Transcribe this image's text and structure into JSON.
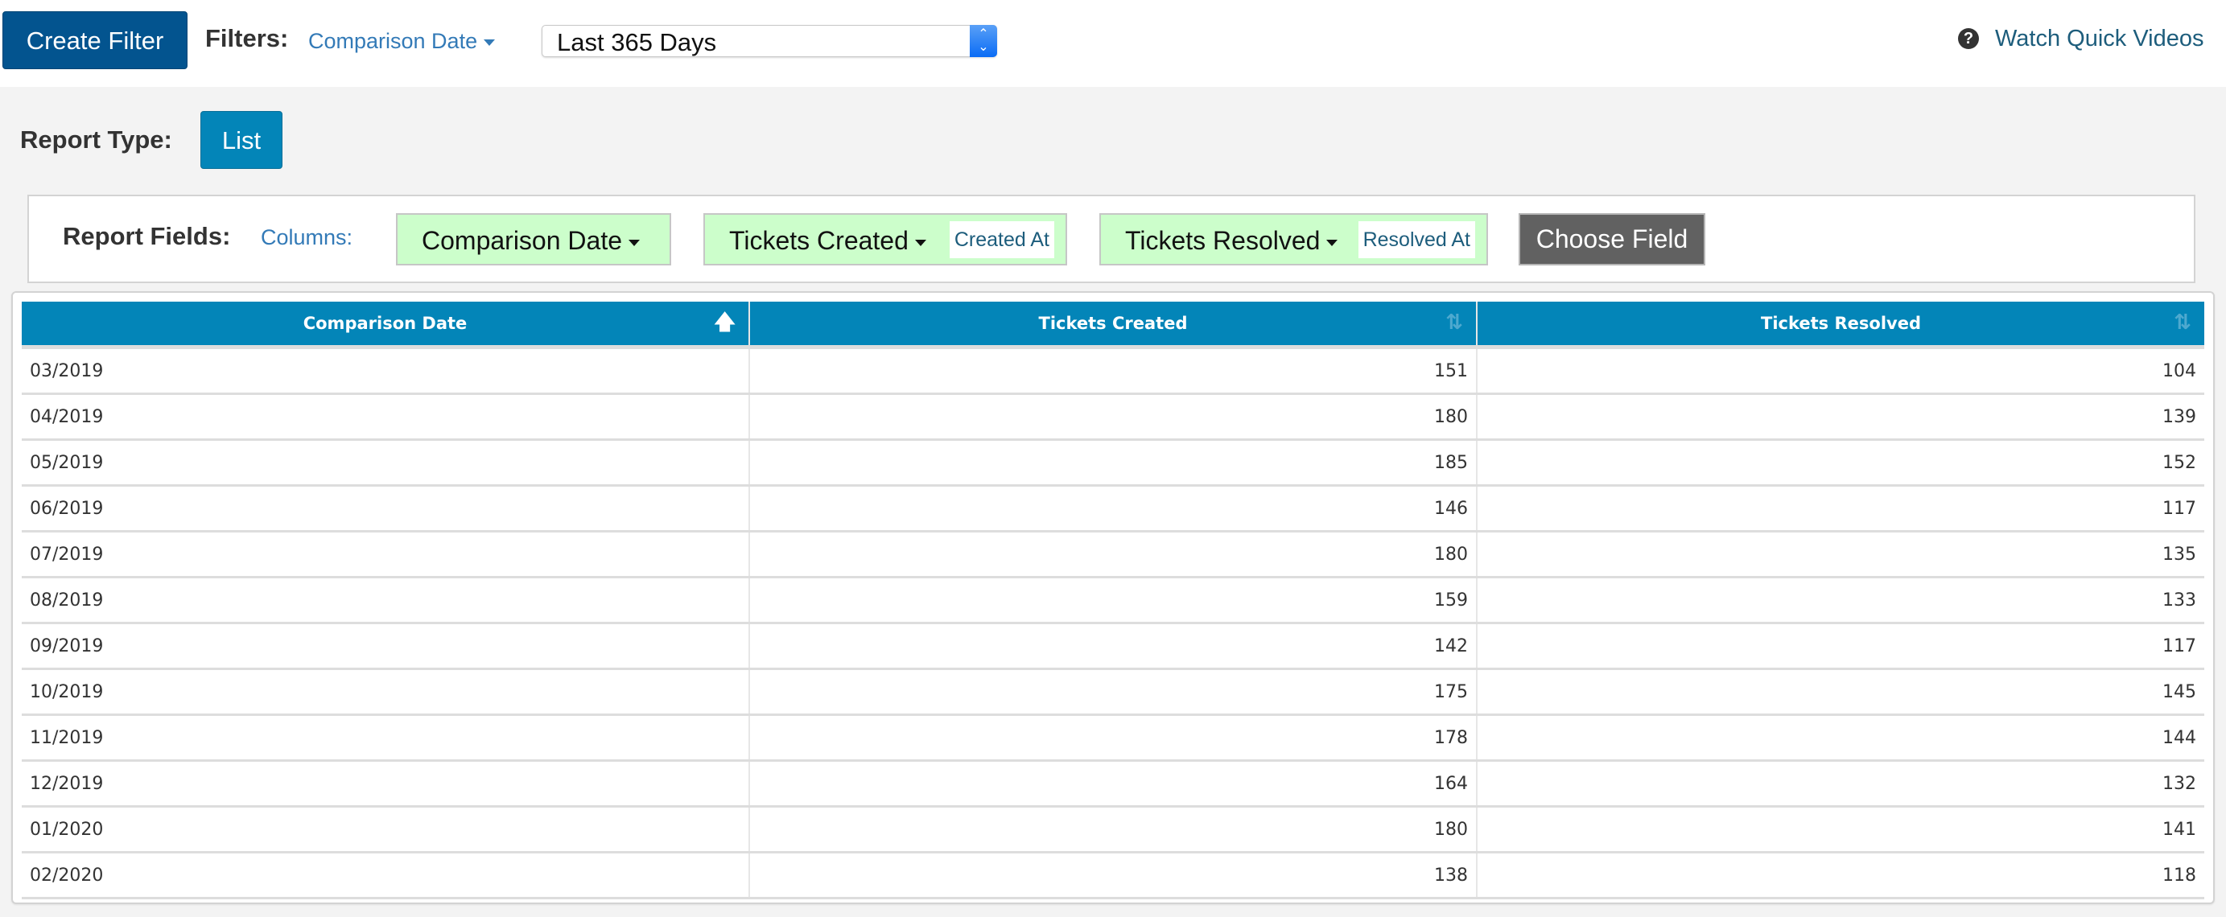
{
  "topbar": {
    "create_filter_label": "Create Filter",
    "filters_label": "Filters:",
    "filter_field": "Comparison Date",
    "date_range_value": "Last 365 Days",
    "help_icon": "question-circle-icon",
    "watch_videos_label": "Watch Quick Videos"
  },
  "report_type": {
    "label": "Report Type:",
    "value": "List"
  },
  "report_fields": {
    "label": "Report Fields:",
    "columns_label": "Columns:",
    "fields": [
      {
        "name": "Comparison Date",
        "sub": null
      },
      {
        "name": "Tickets Created",
        "sub": "Created At"
      },
      {
        "name": "Tickets Resolved",
        "sub": "Resolved At"
      }
    ],
    "choose_field_label": "Choose Field",
    "chip_color": "#ccfecb"
  },
  "table": {
    "header_color": "#0385b8",
    "columns": [
      {
        "label": "Comparison Date",
        "sort": "asc",
        "sort_icon": "sort-up-arrow-icon"
      },
      {
        "label": "Tickets Created",
        "sort": "none",
        "sort_icon": "sort-both-icon"
      },
      {
        "label": "Tickets Resolved",
        "sort": "none",
        "sort_icon": "sort-both-icon"
      }
    ],
    "rows": [
      [
        "03/2019",
        "151",
        "104"
      ],
      [
        "04/2019",
        "180",
        "139"
      ],
      [
        "05/2019",
        "185",
        "152"
      ],
      [
        "06/2019",
        "146",
        "117"
      ],
      [
        "07/2019",
        "180",
        "135"
      ],
      [
        "08/2019",
        "159",
        "133"
      ],
      [
        "09/2019",
        "142",
        "117"
      ],
      [
        "10/2019",
        "175",
        "145"
      ],
      [
        "11/2019",
        "178",
        "144"
      ],
      [
        "12/2019",
        "164",
        "132"
      ],
      [
        "01/2020",
        "180",
        "141"
      ],
      [
        "02/2020",
        "138",
        "118"
      ]
    ]
  }
}
